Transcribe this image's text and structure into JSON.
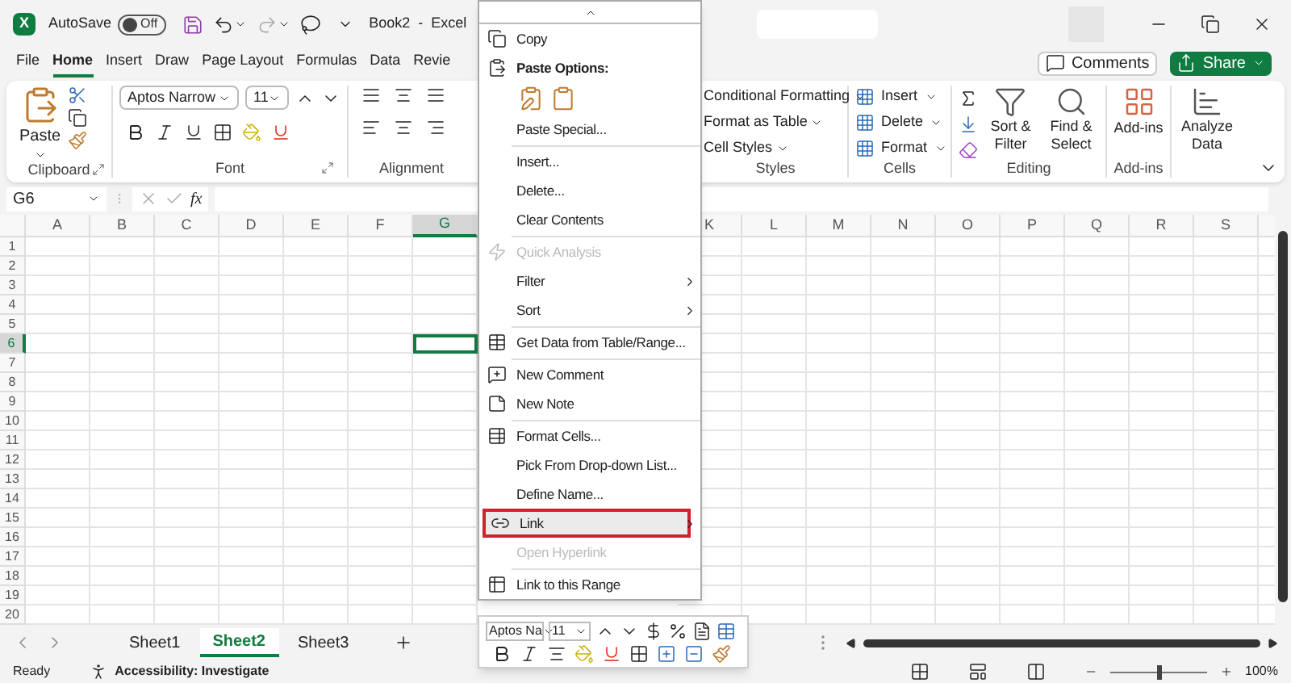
{
  "title_bar": {
    "logo": "X",
    "autosave": {
      "label": "AutoSave",
      "on": false,
      "state_text": "Off"
    },
    "document_title": "Book2  -  Excel"
  },
  "ribbon_tabs": [
    {
      "label": "File",
      "selected": false
    },
    {
      "label": "Home",
      "selected": true
    },
    {
      "label": "Insert",
      "selected": false
    },
    {
      "label": "Draw",
      "selected": false
    },
    {
      "label": "Page Layout",
      "selected": false
    },
    {
      "label": "Formulas",
      "selected": false
    },
    {
      "label": "Data",
      "selected": false
    },
    {
      "label": "Revie",
      "selected": false
    }
  ],
  "comments_button": "Comments",
  "share_button": "Share",
  "ribbon": {
    "clipboard": {
      "paste": "Paste",
      "label": "Clipboard"
    },
    "font": {
      "font_name": "Aptos Narrow",
      "font_size": "11",
      "label": "Font"
    },
    "alignment": {
      "label": "Alignment"
    },
    "styles": {
      "items": [
        "Conditional Formatting",
        "Format as Table",
        "Cell Styles"
      ],
      "label": "Styles"
    },
    "cells": {
      "items": [
        "Insert",
        "Delete",
        "Format"
      ],
      "label": "Cells"
    },
    "editing": {
      "sort": "Sort & Filter",
      "find": "Find & Select",
      "label": "Editing"
    },
    "addins": {
      "button": "Add-ins",
      "label": "Add-ins"
    },
    "analyze": {
      "button": "Analyze Data"
    }
  },
  "formula_bar": {
    "name_box": "G6",
    "fx": "fx"
  },
  "grid": {
    "column_groups": [
      [
        {
          "label": "A",
          "selected": false
        },
        {
          "label": "B",
          "selected": false
        },
        {
          "label": "C",
          "selected": false
        },
        {
          "label": "D",
          "selected": false
        },
        {
          "label": "E",
          "selected": false
        },
        {
          "label": "F",
          "selected": false
        },
        {
          "label": "G",
          "selected": true
        }
      ],
      [
        {
          "label": "K",
          "selected": false
        },
        {
          "label": "L",
          "selected": false
        },
        {
          "label": "M",
          "selected": false
        },
        {
          "label": "N",
          "selected": false
        },
        {
          "label": "O",
          "selected": false
        },
        {
          "label": "P",
          "selected": false
        },
        {
          "label": "Q",
          "selected": false
        },
        {
          "label": "R",
          "selected": false
        },
        {
          "label": "S",
          "selected": false
        }
      ]
    ],
    "rows": [
      {
        "label": "1",
        "selected": false
      },
      {
        "label": "2",
        "selected": false
      },
      {
        "label": "3",
        "selected": false
      },
      {
        "label": "4",
        "selected": false
      },
      {
        "label": "5",
        "selected": false
      },
      {
        "label": "6",
        "selected": true
      },
      {
        "label": "7",
        "selected": false
      },
      {
        "label": "8",
        "selected": false
      },
      {
        "label": "9",
        "selected": false
      },
      {
        "label": "10",
        "selected": false
      },
      {
        "label": "11",
        "selected": false
      },
      {
        "label": "12",
        "selected": false
      },
      {
        "label": "13",
        "selected": false
      },
      {
        "label": "14",
        "selected": false
      },
      {
        "label": "15",
        "selected": false
      },
      {
        "label": "16",
        "selected": false
      },
      {
        "label": "17",
        "selected": false
      },
      {
        "label": "18",
        "selected": false
      },
      {
        "label": "19",
        "selected": false
      },
      {
        "label": "20",
        "selected": false
      }
    ]
  },
  "context_menu": [
    {
      "kind": "item",
      "label": "Copy",
      "disabled": false,
      "submenu": false,
      "highlighted": false
    },
    {
      "kind": "header",
      "label": "Paste Options:"
    },
    {
      "kind": "paste_icons"
    },
    {
      "kind": "item",
      "label": "Paste Special...",
      "disabled": false,
      "submenu": false,
      "highlighted": false
    },
    {
      "kind": "separator"
    },
    {
      "kind": "item",
      "label": "Insert...",
      "disabled": false,
      "submenu": false,
      "highlighted": false
    },
    {
      "kind": "item",
      "label": "Delete...",
      "disabled": false,
      "submenu": false,
      "highlighted": false
    },
    {
      "kind": "item",
      "label": "Clear Contents",
      "disabled": false,
      "submenu": false,
      "highlighted": false
    },
    {
      "kind": "separator"
    },
    {
      "kind": "item",
      "label": "Quick Analysis",
      "disabled": true,
      "submenu": false,
      "highlighted": false
    },
    {
      "kind": "item",
      "label": "Filter",
      "disabled": false,
      "submenu": true,
      "highlighted": false
    },
    {
      "kind": "item",
      "label": "Sort",
      "disabled": false,
      "submenu": true,
      "highlighted": false
    },
    {
      "kind": "separator"
    },
    {
      "kind": "item",
      "label": "Get Data from Table/Range...",
      "disabled": false,
      "submenu": false,
      "highlighted": false
    },
    {
      "kind": "separator"
    },
    {
      "kind": "item",
      "label": "New Comment",
      "disabled": false,
      "submenu": false,
      "highlighted": false
    },
    {
      "kind": "item",
      "label": "New Note",
      "disabled": false,
      "submenu": false,
      "highlighted": false
    },
    {
      "kind": "separator"
    },
    {
      "kind": "item",
      "label": "Format Cells...",
      "disabled": false,
      "submenu": false,
      "highlighted": false
    },
    {
      "kind": "item",
      "label": "Pick From Drop-down List...",
      "disabled": false,
      "submenu": false,
      "highlighted": false
    },
    {
      "kind": "item",
      "label": "Define Name...",
      "disabled": false,
      "submenu": false,
      "highlighted": false
    },
    {
      "kind": "item",
      "label": "Link",
      "disabled": false,
      "submenu": true,
      "highlighted": true
    },
    {
      "kind": "item",
      "label": "Open Hyperlink",
      "disabled": true,
      "submenu": false,
      "highlighted": false
    },
    {
      "kind": "separator"
    },
    {
      "kind": "item",
      "label": "Link to this Range",
      "disabled": false,
      "submenu": false,
      "highlighted": false
    }
  ],
  "mini_toolbar": {
    "font_name": "Aptos Na",
    "font_size": "11"
  },
  "sheet_tabs": [
    {
      "label": "Sheet1",
      "selected": false
    },
    {
      "label": "Sheet2",
      "selected": true
    },
    {
      "label": "Sheet3",
      "selected": false
    }
  ],
  "status_bar": {
    "ready": "Ready",
    "accessibility": "Accessibility: Investigate",
    "zoom": {
      "level": 0.5,
      "reading": "100%"
    }
  }
}
